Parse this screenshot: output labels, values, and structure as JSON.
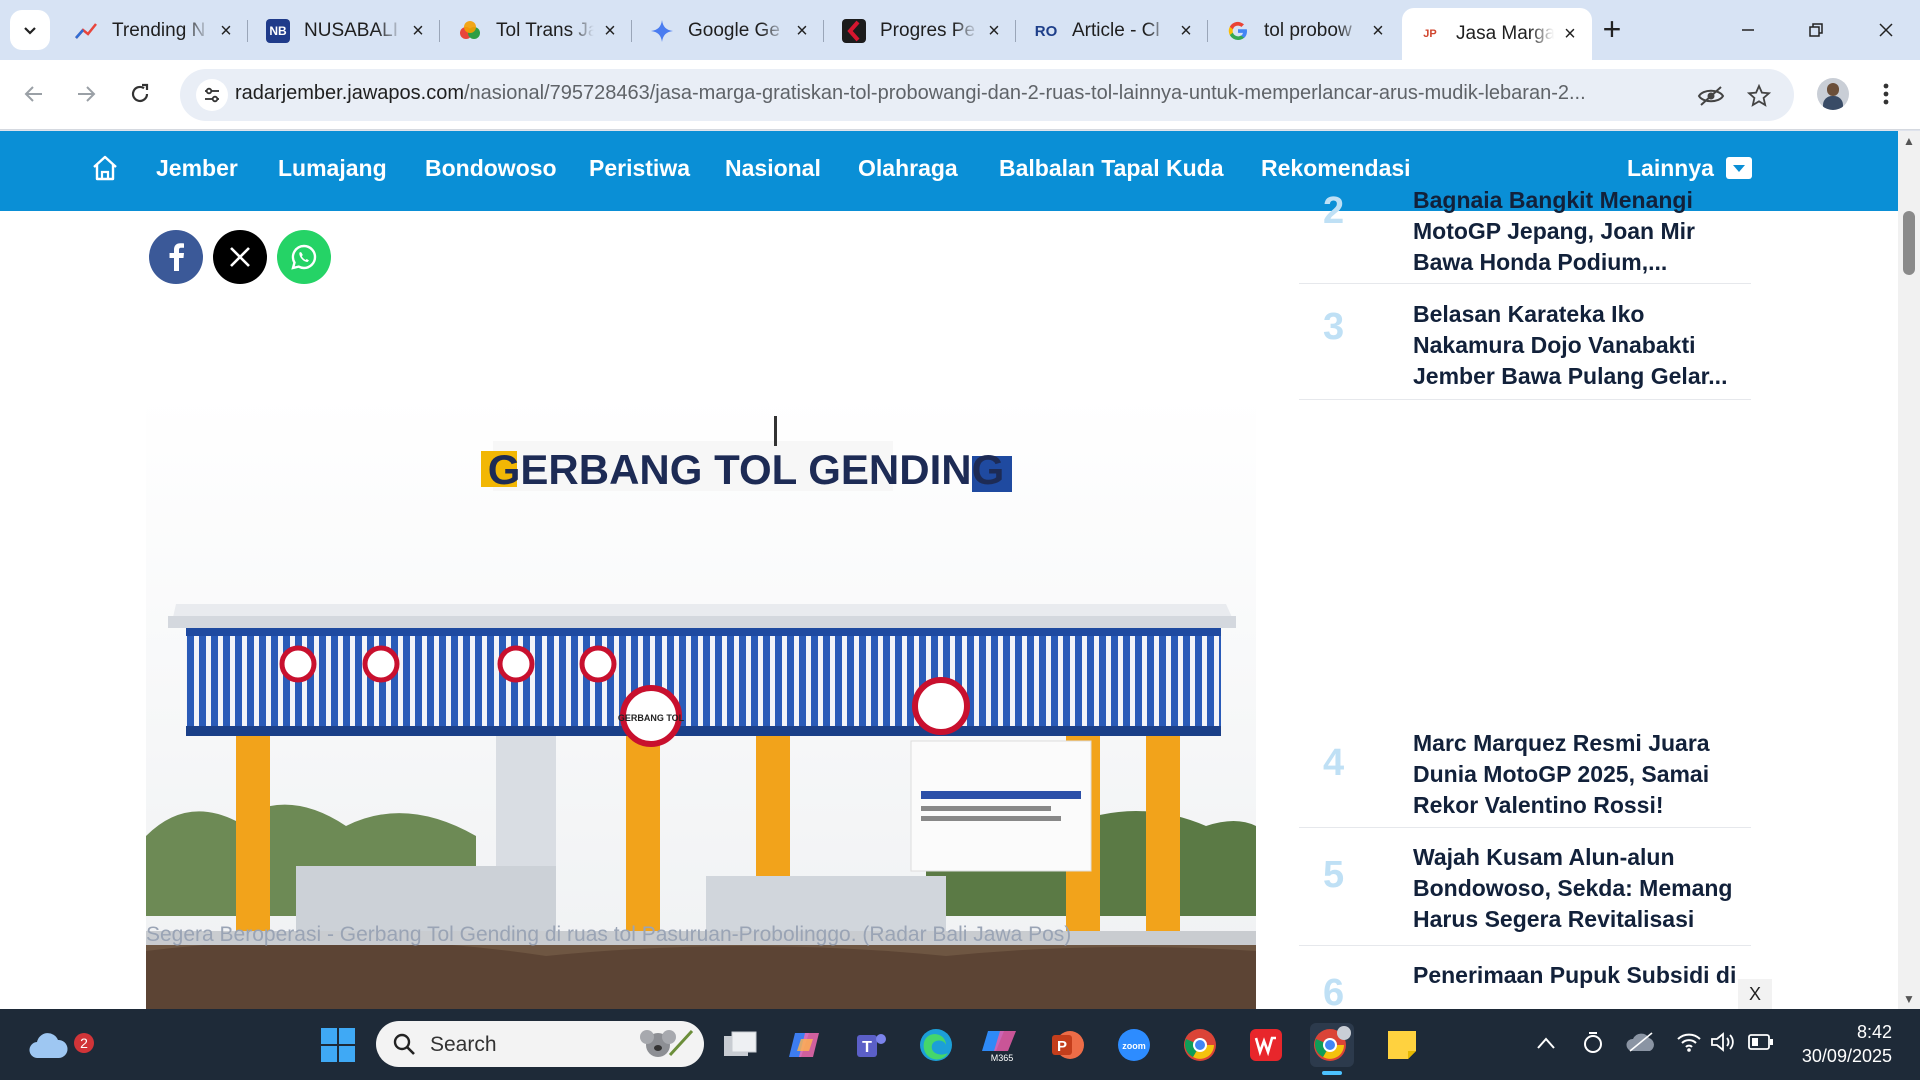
{
  "browser": {
    "tabs": [
      {
        "title": "Trending N",
        "favicon": "trending-chart-icon",
        "color": "#2f6fd6"
      },
      {
        "title": "NUSABALI",
        "favicon": "nb-logo-icon",
        "color": "#1f3b8a"
      },
      {
        "title": "Tol Trans Ja",
        "favicon": "news-network-icon",
        "color": "#e67b1c"
      },
      {
        "title": "Google Ge",
        "favicon": "gemini-spark-icon",
        "color": "#4a7cf0"
      },
      {
        "title": "Progres Pe",
        "favicon": "kompas-icon",
        "color": "#b3122b"
      },
      {
        "title": "Article - Cl",
        "favicon": "article-icon",
        "color": "#1e3f8a"
      },
      {
        "title": "tol probow",
        "favicon": "google-g-icon",
        "color": "#4285f4"
      },
      {
        "title": "Jasa Marga",
        "favicon": "jawapos-icon",
        "color": "#d0452e",
        "active": true
      }
    ],
    "url_host": "radarjember.jawapos.com",
    "url_path": "/nasional/795728463/jasa-marga-gratiskan-tol-probowangi-dan-2-ruas-tol-lainnya-untuk-memperlancar-arus-mudik-lebaran-2..."
  },
  "site": {
    "nav": [
      "Jember",
      "Lumajang",
      "Bondowoso",
      "Peristiwa",
      "Nasional",
      "Olahraga",
      "Balbalan Tapal Kuda",
      "Rekomendasi"
    ],
    "nav_more": "Lainnya",
    "share": [
      "facebook-icon",
      "x-icon",
      "whatsapp-icon"
    ]
  },
  "article": {
    "photo_sign": "GERBANG TOL GENDING",
    "photo_small_sign": "GERBANG TOL",
    "caption": "Segera Beroperasi - Gerbang Tol Gending di ruas tol Pasuruan-Probolinggo. (Radar Bali Jawa Pos)"
  },
  "trending": [
    {
      "num": "2",
      "title": "Bagnaia Bangkit Menangi MotoGP Jepang, Joan Mir Bawa Honda Podium,..."
    },
    {
      "num": "3",
      "title": "Belasan Karateka Iko Nakamura Dojo Vanabakti Jember Bawa Pulang Gelar..."
    },
    {
      "num": "4",
      "title": "Marc Marquez Resmi Juara Dunia MotoGP 2025, Samai Rekor Valentino Rossi!"
    },
    {
      "num": "5",
      "title": "Wajah Kusam Alun-alun Bondowoso, Sekda: Memang Harus Segera Revitalisasi"
    },
    {
      "num": "6",
      "title": "Penerimaan Pupuk Subsidi di"
    }
  ],
  "ad_close": "X",
  "taskbar": {
    "weather_badge": "2",
    "search_label": "Search",
    "time": "8:42",
    "date": "30/09/2025"
  }
}
